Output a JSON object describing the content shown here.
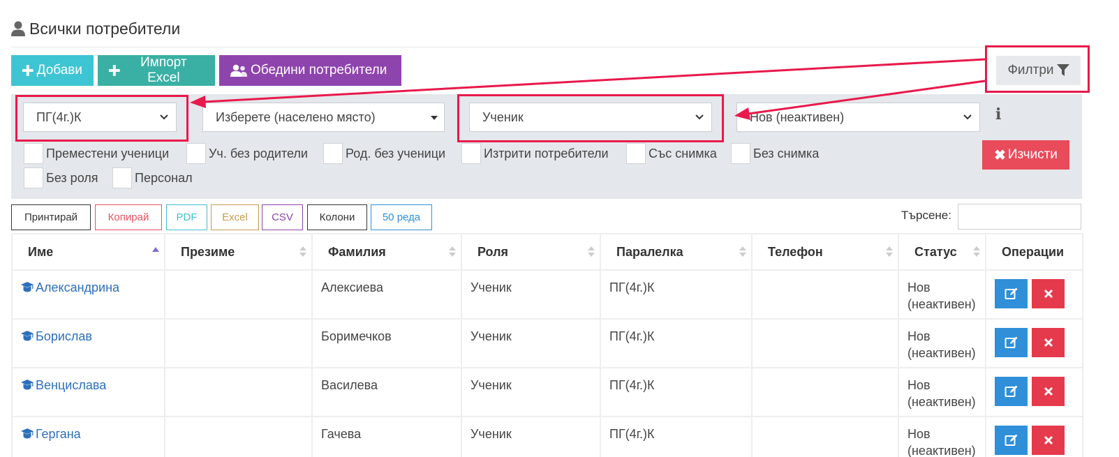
{
  "page": {
    "title": "Всички потребители"
  },
  "toolbar": {
    "add_label": "Добави",
    "import_label": "Импорт Excel",
    "merge_label": "Обедини потребители",
    "filters_label": "Филтри"
  },
  "filters": {
    "class_value": "ПГ(4г.)К",
    "city_value": "Изберете (населено място)",
    "role_value": "Ученик",
    "status_value": "Нов (неактивен)",
    "clear_label": "Изчисти",
    "info_glyph": "i",
    "checkboxes": [
      "Преместени ученици",
      "Уч. без родители",
      "Род. без ученици",
      "Изтрити потребители",
      "Със снимка",
      "Без снимка",
      "Без роля",
      "Персонал"
    ]
  },
  "datatable": {
    "buttons": [
      "Принтирай",
      "Копирай",
      "PDF",
      "Excel",
      "CSV",
      "Колони",
      "50 реда"
    ],
    "button_colors": [
      "#333333",
      "#e5535f",
      "#40bfd0",
      "#c99a4e",
      "#8e44ad",
      "#333333",
      "#2f8fd8"
    ],
    "search_label": "Търсене:",
    "search_value": ""
  },
  "table": {
    "headers": [
      "Име",
      "Презиме",
      "Фамилия",
      "Роля",
      "Паралелка",
      "Телефон",
      "Статус",
      "Операции"
    ],
    "rows": [
      {
        "name": "Александрина",
        "middle": "",
        "last": "Алексиева",
        "role": "Ученик",
        "class": "ПГ(4г.)К",
        "phone": "",
        "status": "Нов (неактивен)"
      },
      {
        "name": "Борислав",
        "middle": "",
        "last": "Боримечков",
        "role": "Ученик",
        "class": "ПГ(4г.)К",
        "phone": "",
        "status": "Нов (неактивен)"
      },
      {
        "name": "Венцислава",
        "middle": "",
        "last": "Василева",
        "role": "Ученик",
        "class": "ПГ(4г.)К",
        "phone": "",
        "status": "Нов (неактивен)"
      },
      {
        "name": "Гергана",
        "middle": "",
        "last": "Гачева",
        "role": "Ученик",
        "class": "ПГ(4г.)К",
        "phone": "",
        "status": "Нов (неактивен)"
      }
    ]
  },
  "colors": {
    "accent_cyan": "#3ec5d3",
    "accent_teal": "#3ab0a4",
    "accent_purple": "#8e44ad",
    "danger": "#e94b5a",
    "primary": "#2f8fd8",
    "annotation": "#e8194b"
  },
  "icons": {
    "title": "user-icon",
    "add": "plus-icon",
    "merge": "users-icon",
    "filters": "filter-icon",
    "clear": "times-icon",
    "info": "info-icon",
    "row": "graduation-cap-icon",
    "edit": "edit-icon",
    "delete": "times-icon"
  }
}
